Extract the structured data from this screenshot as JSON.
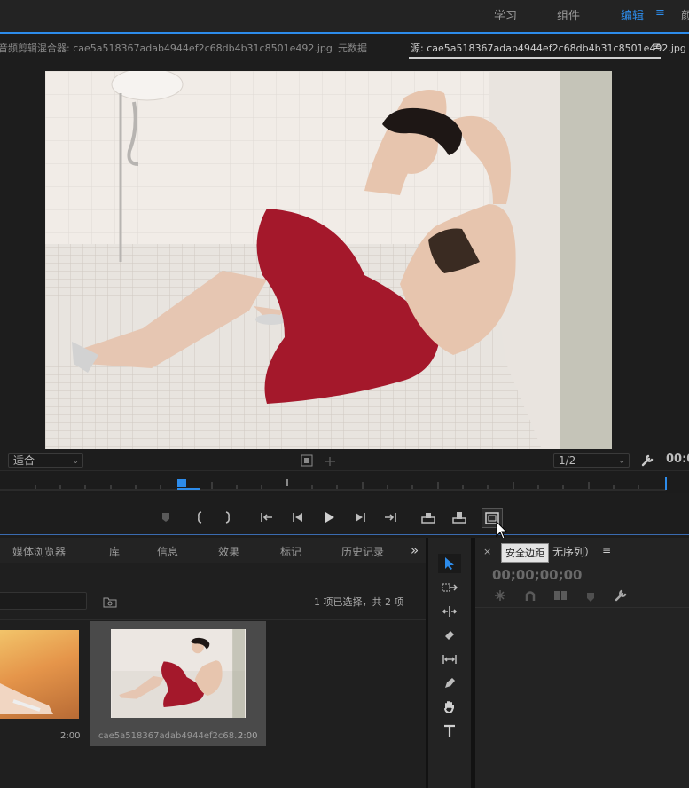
{
  "workspace": {
    "items": [
      {
        "label": "学习"
      },
      {
        "label": "组件"
      },
      {
        "label": "编辑"
      }
    ],
    "overflow_label": "≡",
    "clipped_label": "颜"
  },
  "panel_tabs": {
    "mixer": "音频剪辑混合器: cae5a518367adab4944ef2c68db4b31c8501e492.jpg",
    "metadata": "元数据",
    "source": "源: cae5a518367adab4944ef2c68db4b31c8501e492.jpg",
    "menu": "≡"
  },
  "monitor": {
    "zoom_value": "适合",
    "resolution_value": "1/2",
    "timecode_clipped": "00:0"
  },
  "project_panel": {
    "tabs": [
      {
        "label": "媒体浏览器"
      },
      {
        "label": "库"
      },
      {
        "label": "信息"
      },
      {
        "label": "效果"
      },
      {
        "label": "标记"
      },
      {
        "label": "历史记录"
      }
    ],
    "overflow": "»",
    "search_placeholder": "",
    "selection_status": "1 项已选择，共 2 项",
    "items": [
      {
        "name": "",
        "duration": "2:00"
      },
      {
        "name": "cae5a518367adab4944ef2c68...",
        "duration": "2:00"
      }
    ]
  },
  "timeline_panel": {
    "close": "×",
    "title_clipped": "无序列）",
    "menu": "≡",
    "timecode": "00;00;00;00"
  },
  "tooltip": {
    "text": "安全边距"
  },
  "colors": {
    "accent": "#2d8ceb",
    "panel_bg": "#232323"
  }
}
